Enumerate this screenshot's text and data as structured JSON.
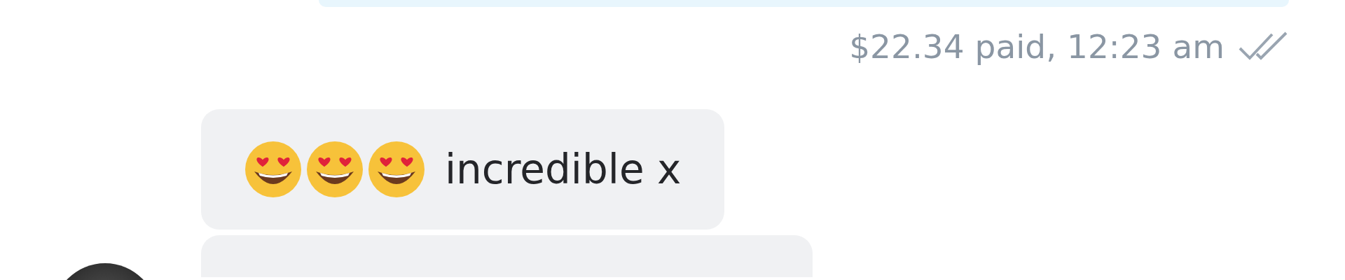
{
  "messages": [
    {
      "kind": "outgoing-partial"
    },
    {
      "kind": "meta",
      "text": "$22.34 paid, 12:23 am",
      "read": true
    },
    {
      "kind": "incoming",
      "emojis": [
        {
          "kind": "heart-eyes"
        },
        {
          "kind": "heart-eyes"
        },
        {
          "kind": "heart-eyes"
        }
      ],
      "text": "incredible x",
      "avatar": false
    },
    {
      "kind": "incoming-partial",
      "avatar": true
    }
  ]
}
